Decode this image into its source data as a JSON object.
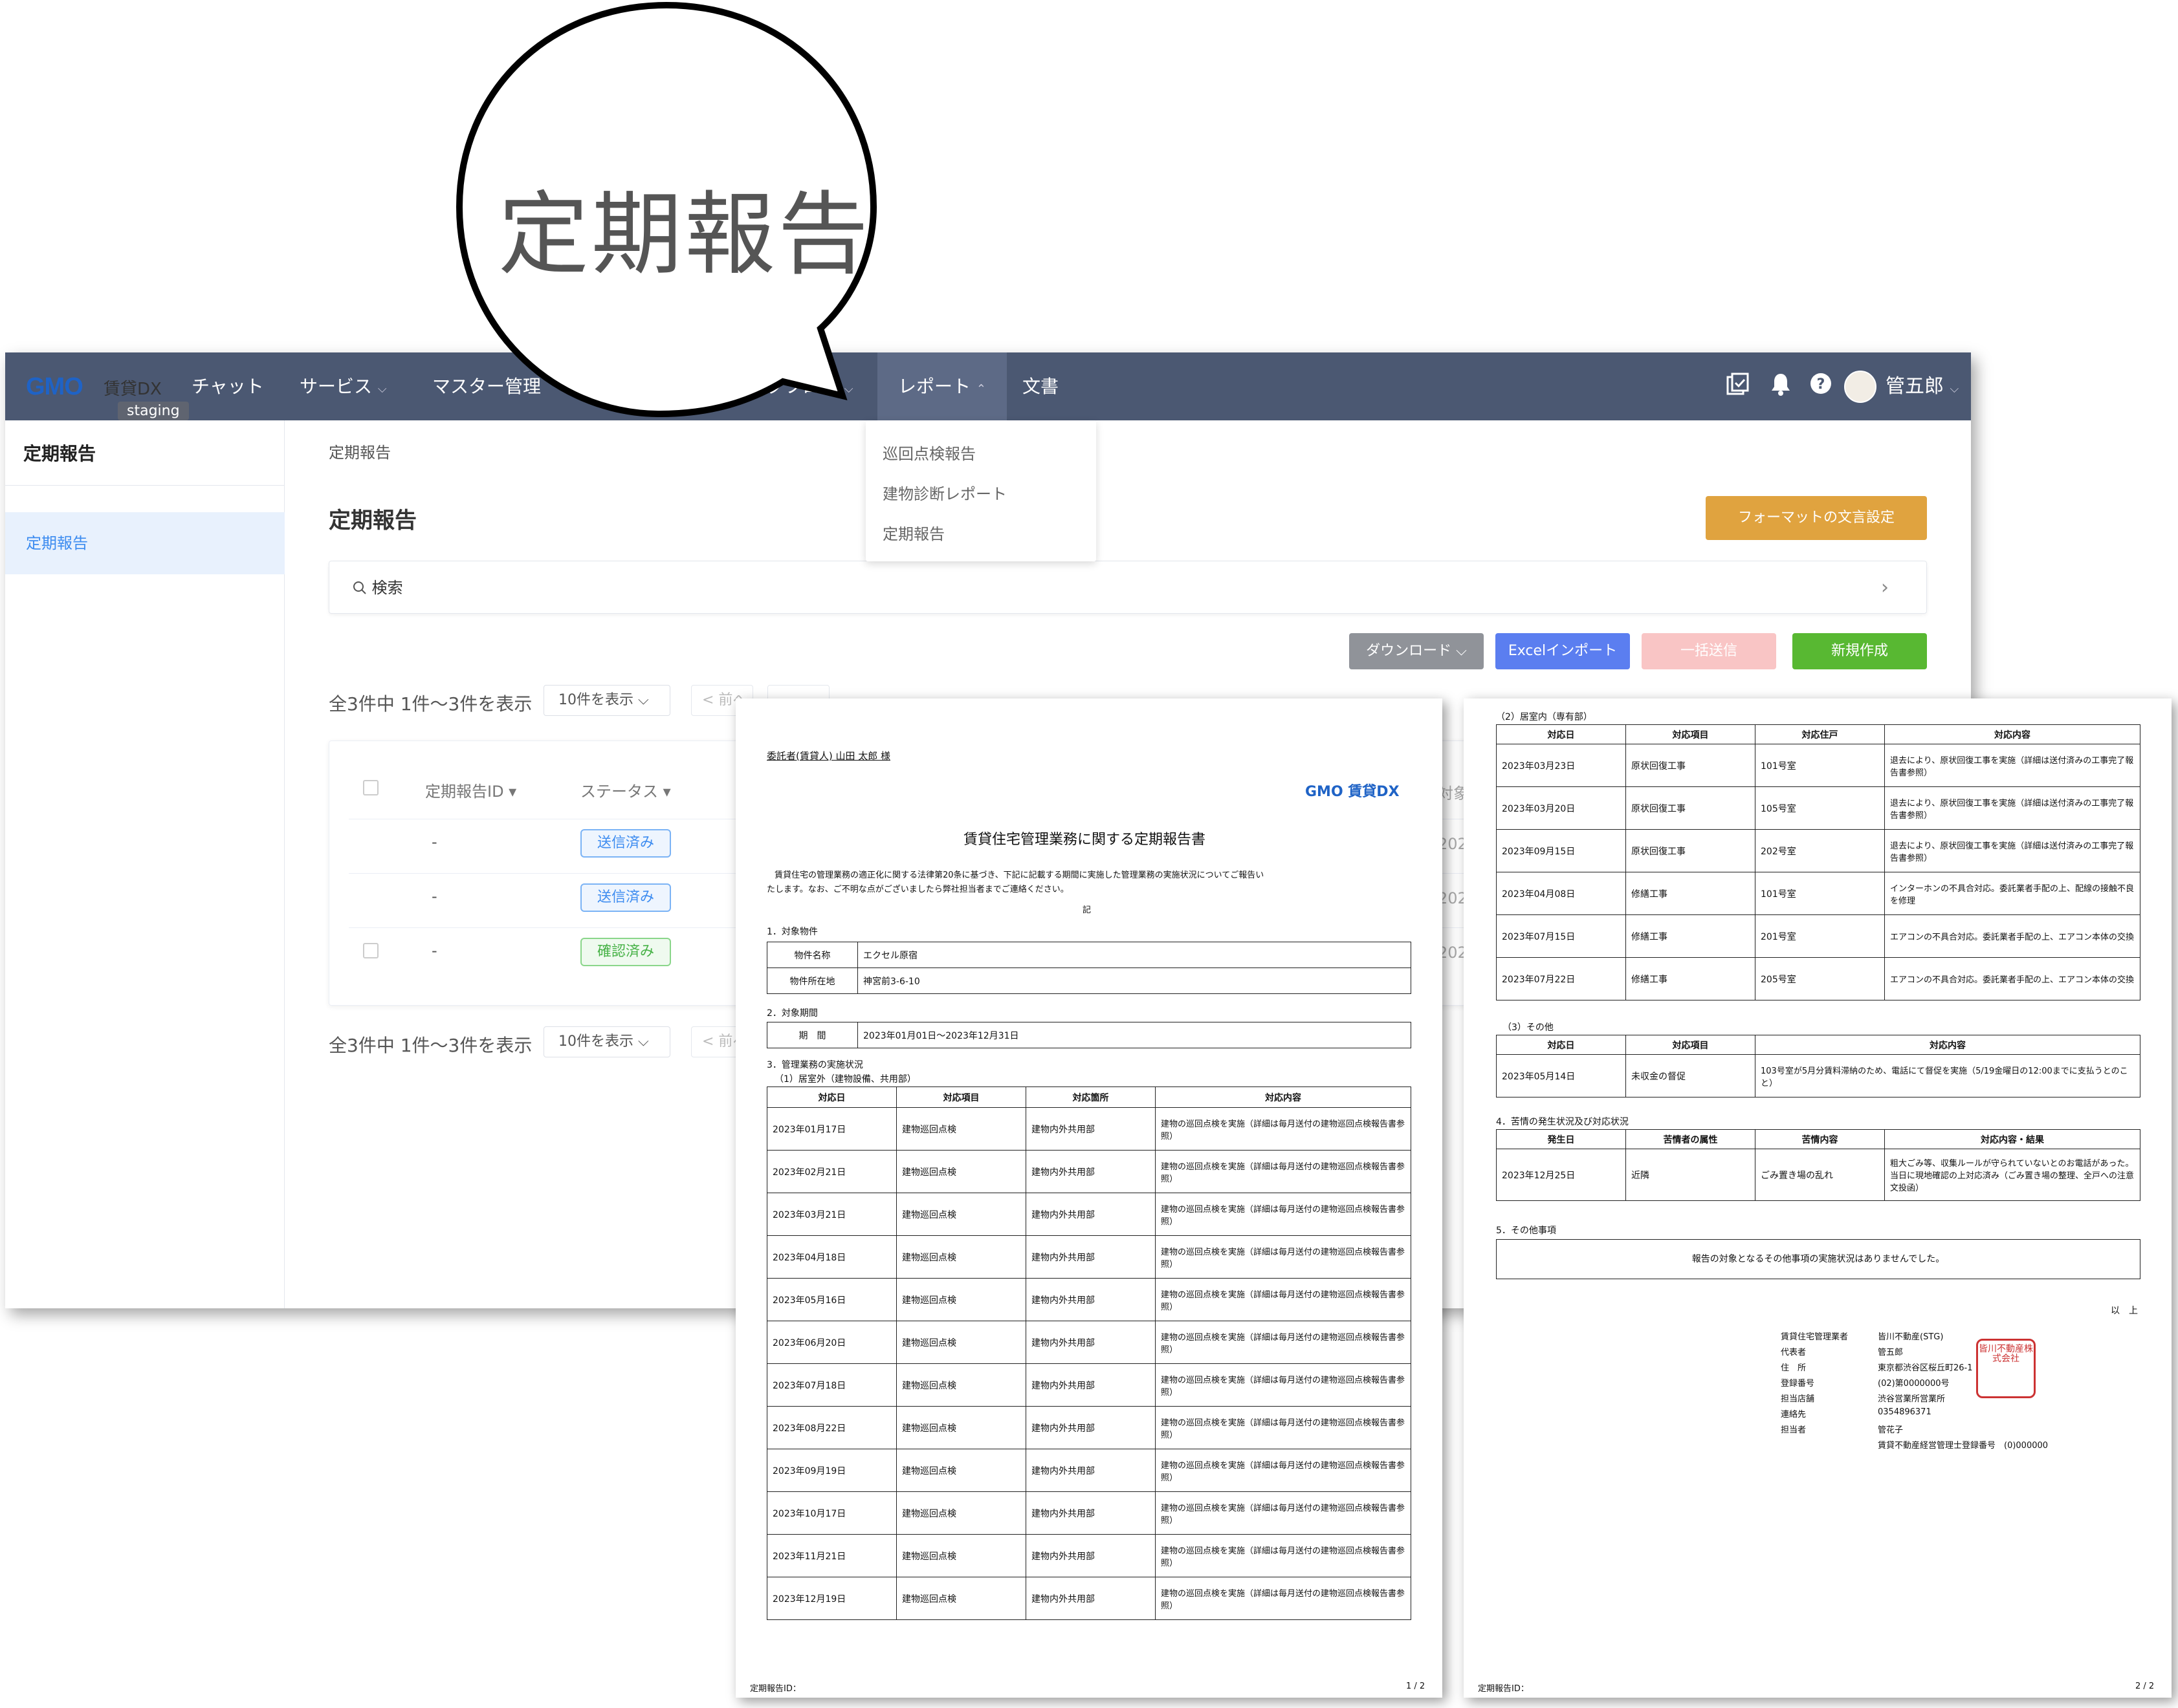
{
  "bubble": {
    "text": "定期報告"
  },
  "nav": {
    "logo": "GMO",
    "logo_sub": "賃貸DX",
    "env": "staging",
    "items": [
      {
        "label": "チャット",
        "caret": ""
      },
      {
        "label": "サービス",
        "caret": "⌵"
      },
      {
        "label": "マスター管理",
        "caret": ""
      },
      {
        "label": "ークフロー",
        "caret": "⌵"
      },
      {
        "label": "レポート",
        "caret": "⌃"
      },
      {
        "label": "文書",
        "caret": ""
      }
    ],
    "user": "管五郎",
    "user_caret": "⌵"
  },
  "dropdown": [
    "巡回点検報告",
    "建物診断レポート",
    "定期報告"
  ],
  "sidebar": {
    "title": "定期報告",
    "item": "定期報告"
  },
  "main": {
    "breadcrumb": "定期報告",
    "title": "定期報告",
    "format_button": "フォーマットの文言設定",
    "search_placeholder": "検索",
    "search_arrow": "›",
    "buttons": {
      "download": "ダウンロード ⌵",
      "excel": "Excelインポート",
      "bulk": "一括送信",
      "new": "新規作成"
    },
    "pager_text": "全3件中 1件〜3件を表示",
    "page_size": "10件を表示 ⌵",
    "prev": "< 前へ",
    "columns": [
      "定期報告ID ▾",
      "ステータス ▾"
    ],
    "rows": [
      {
        "id": "-",
        "status": "送信済み"
      },
      {
        "id": "-",
        "status": "送信済み"
      },
      {
        "id": "-",
        "status": "確認済み"
      }
    ],
    "side_fragments": [
      "対象",
      "202",
      "202",
      "202"
    ]
  },
  "doc1": {
    "addressee": "委託者(賃貸人)  山田 太郎  様",
    "logo": "GMO 賃貸DX",
    "title": "賃貸住宅管理業務に関する定期報告書",
    "intro1": "賃貸住宅の管理業務の適正化に関する法律第20条に基づき、下記に記載する期間に実施した管理業務の実施状況についてご報告い",
    "intro2": "たします。なお、ご不明な点がございましたら弊社担当者までご連絡ください。",
    "ki": "記",
    "s1": "1．対象物件",
    "prop_name_label": "物件名称",
    "prop_name": "エクセル原宿",
    "prop_addr_label": "物件所在地",
    "prop_addr": "神宮前3-6-10",
    "s2": "2．対象期間",
    "period_label": "期　間",
    "period": "2023年01月01日～2023年12月31日",
    "s3": "3．管理業務の実施状況",
    "s3_1": "（1）居室外（建物設備、共用部）",
    "cols": [
      "対応日",
      "対応項目",
      "対応箇所",
      "対応内容"
    ],
    "item": "建物巡回点検",
    "place": "建物内外共用部",
    "content": "建物の巡回点検を実施（詳細は毎月送付の建物巡回点検報告書参照）",
    "dates": [
      "2023年01月17日",
      "2023年02月21日",
      "2023年03月21日",
      "2023年04月18日",
      "2023年05月16日",
      "2023年06月20日",
      "2023年07月18日",
      "2023年08月22日",
      "2023年09月19日",
      "2023年10月17日",
      "2023年11月21日",
      "2023年12月19日"
    ],
    "footer_id": "定期報告ID：",
    "page": "1 / 2"
  },
  "doc2": {
    "s3_2": "（2）居室内（専有部）",
    "cols": [
      "対応日",
      "対応項目",
      "対応住戸",
      "対応内容"
    ],
    "rows": [
      [
        "2023年03月23日",
        "原状回復工事",
        "101号室",
        "退去により、原状回復工事を実施（詳細は送付済みの工事完了報告書参照）"
      ],
      [
        "2023年03月20日",
        "原状回復工事",
        "105号室",
        "退去により、原状回復工事を実施（詳細は送付済みの工事完了報告書参照）"
      ],
      [
        "2023年09月15日",
        "原状回復工事",
        "202号室",
        "退去により、原状回復工事を実施（詳細は送付済みの工事完了報告書参照）"
      ],
      [
        "2023年04月08日",
        "修繕工事",
        "101号室",
        "インターホンの不具合対応。委託業者手配の上、配線の接触不良を修理"
      ],
      [
        "2023年07月15日",
        "修繕工事",
        "201号室",
        "エアコンの不具合対応。委託業者手配の上、エアコン本体の交換"
      ],
      [
        "2023年07月22日",
        "修繕工事",
        "205号室",
        "エアコンの不具合対応。委託業者手配の上、エアコン本体の交換"
      ]
    ],
    "s3_3": "（3）その他",
    "other_cols": [
      "対応日",
      "対応項目",
      "対応内容"
    ],
    "other_row": [
      "2023年05月14日",
      "未収金の督促",
      "103号室が5月分賃料滞納のため、電話にて督促を実施（5/19金曜日の12:00までに支払うとのこと）"
    ],
    "s4": "4．苦情の発生状況及び対応状況",
    "comp_cols": [
      "発生日",
      "苦情者の属性",
      "苦情内容",
      "対応内容・結果"
    ],
    "comp_row": [
      "2023年12月25日",
      "近隣",
      "ごみ置き場の乱れ",
      "粗大ごみ等、収集ルールが守られていないとのお電話があった。当日に現地確認の上対応済み（ごみ置き場の整理、全戸への注意文投函）"
    ],
    "s5": "5．その他事項",
    "s5_text": "報告の対象となるその他事項の実施状況はありませんでした。",
    "ijo": "以　上",
    "sig": [
      [
        "賃貸住宅管理業者",
        "皆川不動産(STG)"
      ],
      [
        "代表者",
        "管五郎"
      ],
      [
        "住　所",
        "東京都渋谷区桜丘町26-1"
      ],
      [
        "登録番号",
        "(02)第0000000号"
      ],
      [
        "担当店舗",
        "渋谷営業所営業所"
      ],
      [
        "連絡先",
        "0354896371"
      ],
      [
        "担当者",
        "管花子"
      ],
      [
        "",
        "賃貸不動産経営管理士登録番号　(0)000000"
      ]
    ],
    "stamp": "皆川不動産株式会社",
    "footer_id": "定期報告ID：",
    "page": "2 / 2"
  }
}
